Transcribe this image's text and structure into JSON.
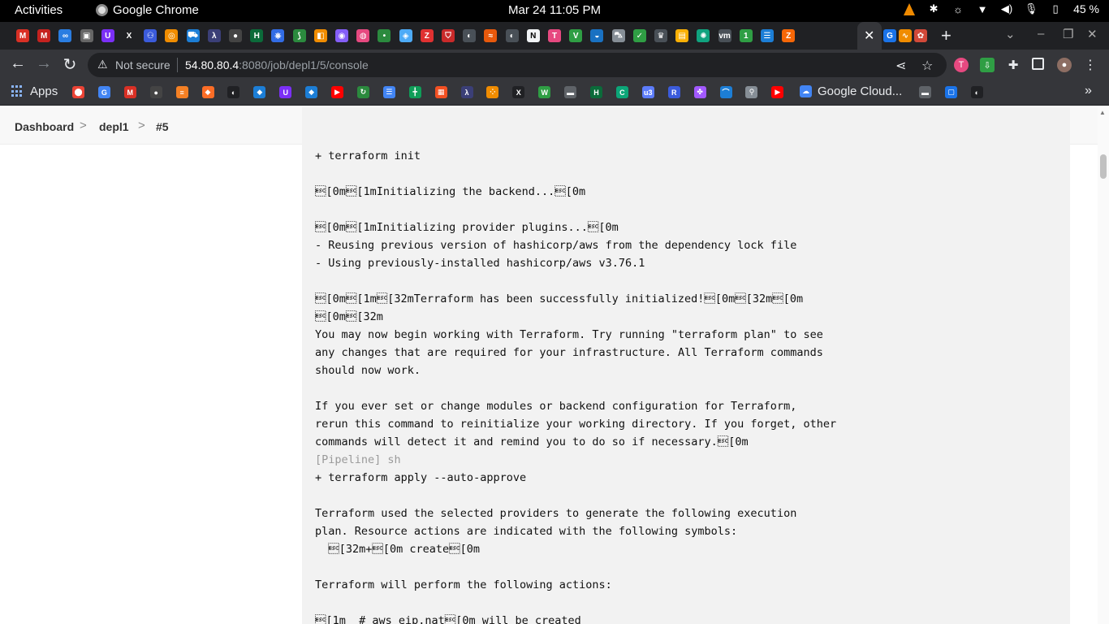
{
  "system_bar": {
    "activities": "Activities",
    "app_name": "Google Chrome",
    "clock": "Mar 24  11:05 PM",
    "battery": "45 %"
  },
  "tabstrip": {
    "favicons": [
      {
        "name": "gmail-icon",
        "color": "#d93025",
        "glyph": "M"
      },
      {
        "name": "gmail-icon",
        "color": "#c5221f",
        "glyph": "M"
      },
      {
        "name": "infinity-icon",
        "color": "#2a7de1",
        "glyph": "∞"
      },
      {
        "name": "terminal-icon",
        "color": "#666666",
        "glyph": "▣"
      },
      {
        "name": "udemy-icon",
        "color": "#7b2ff7",
        "glyph": "U"
      },
      {
        "name": "x-icon",
        "color": "#202124",
        "glyph": "X"
      },
      {
        "name": "users-icon",
        "color": "#3b5bdb",
        "glyph": "⚇"
      },
      {
        "name": "target-icon",
        "color": "#f08c00",
        "glyph": "◎"
      },
      {
        "name": "cart-icon",
        "color": "#1c7ed6",
        "glyph": "⛟"
      },
      {
        "name": "code-icon",
        "color": "#3b3f77",
        "glyph": "λ"
      },
      {
        "name": "github-icon",
        "color": "#444444",
        "glyph": "●"
      },
      {
        "name": "hi-icon",
        "color": "#0b6b3a",
        "glyph": "H"
      },
      {
        "name": "kubernetes-icon",
        "color": "#326ce5",
        "glyph": "⎈"
      },
      {
        "name": "leaf-icon",
        "color": "#2b8a3e",
        "glyph": "⟆"
      },
      {
        "name": "box-icon",
        "color": "#f08c00",
        "glyph": "◧"
      },
      {
        "name": "bot-icon",
        "color": "#845ef7",
        "glyph": "◉"
      },
      {
        "name": "record-icon",
        "color": "#e64980",
        "glyph": "◍"
      },
      {
        "name": "dot-icon",
        "color": "#2b8a3e",
        "glyph": "•"
      },
      {
        "name": "cube-icon",
        "color": "#4dabf7",
        "glyph": "◈"
      },
      {
        "name": "z-icon",
        "color": "#e03131",
        "glyph": "Z"
      },
      {
        "name": "shield-icon",
        "color": "#c92a2a",
        "glyph": "⛉"
      },
      {
        "name": "globe-icon",
        "color": "#495057",
        "glyph": "◐"
      },
      {
        "name": "flame-icon",
        "color": "#e8590c",
        "glyph": "≈"
      },
      {
        "name": "globe-icon",
        "color": "#495057",
        "glyph": "◐"
      },
      {
        "name": "notion-icon",
        "color": "#f1f3f5",
        "glyph": "N"
      },
      {
        "name": "t-icon",
        "color": "#e64980",
        "glyph": "T"
      },
      {
        "name": "v-icon",
        "color": "#2f9e44",
        "glyph": "V"
      },
      {
        "name": "planet-icon",
        "color": "#1971c2",
        "glyph": "◒"
      },
      {
        "name": "car-icon",
        "color": "#868e96",
        "glyph": "⛍"
      },
      {
        "name": "check-icon",
        "color": "#2f9e44",
        "glyph": "✓"
      },
      {
        "name": "crown-icon",
        "color": "#495057",
        "glyph": "♛"
      },
      {
        "name": "sheets-icon",
        "color": "#fab005",
        "glyph": "▤"
      },
      {
        "name": "openai-icon",
        "color": "#10a37f",
        "glyph": "✺"
      },
      {
        "name": "vm-icon",
        "color": "#495057",
        "glyph": "vm"
      },
      {
        "name": "one-icon",
        "color": "#2f9e44",
        "glyph": "1"
      },
      {
        "name": "list-icon",
        "color": "#1c7ed6",
        "glyph": "☰"
      },
      {
        "name": "z-icon",
        "color": "#f76707",
        "glyph": "Z"
      },
      {
        "name": "google-translate-icon",
        "color": "#1a73e8",
        "glyph": "G"
      },
      {
        "name": "grafana-icon",
        "color": "#f08c00",
        "glyph": "∿"
      },
      {
        "name": "jenkins-icon",
        "color": "#d24939",
        "glyph": "✿"
      }
    ]
  },
  "toolbar": {
    "not_secure": "Not secure",
    "url_host": "54.80.80.4",
    "url_path": ":8080/job/depl1/5/console"
  },
  "bookmarks": {
    "apps_label": "Apps",
    "gcloud_label": "Google Cloud...",
    "favicons": [
      {
        "name": "maps-icon",
        "color": "#ea4335",
        "glyph": "⬤"
      },
      {
        "name": "google-translate-icon",
        "color": "#4285f4",
        "glyph": "G"
      },
      {
        "name": "gmail-icon",
        "color": "#d93025",
        "glyph": "M"
      },
      {
        "name": "github-icon",
        "color": "#444444",
        "glyph": "●"
      },
      {
        "name": "stackoverflow-icon",
        "color": "#f48024",
        "glyph": "≡"
      },
      {
        "name": "gitlab-icon",
        "color": "#fc6d26",
        "glyph": "◆"
      },
      {
        "name": "globe-icon",
        "color": "#202124",
        "glyph": "◐"
      },
      {
        "name": "diamond-icon",
        "color": "#1c7ed6",
        "glyph": "◆"
      },
      {
        "name": "udemy-icon",
        "color": "#7b2ff7",
        "glyph": "U"
      },
      {
        "name": "diamond-icon",
        "color": "#1c7ed6",
        "glyph": "◆"
      },
      {
        "name": "youtube-icon",
        "color": "#ff0000",
        "glyph": "▶"
      },
      {
        "name": "refresh-icon",
        "color": "#2b8a3e",
        "glyph": "↻"
      },
      {
        "name": "docs-icon",
        "color": "#4285f4",
        "glyph": "☰"
      },
      {
        "name": "plus-icon",
        "color": "#0f9d58",
        "glyph": "╋"
      },
      {
        "name": "microsoft-icon",
        "color": "#f25022",
        "glyph": "▦"
      },
      {
        "name": "code-icon",
        "color": "#3b3f77",
        "glyph": "λ"
      },
      {
        "name": "nodes-icon",
        "color": "#f08c00",
        "glyph": "⁘"
      },
      {
        "name": "x-icon",
        "color": "#202124",
        "glyph": "X"
      },
      {
        "name": "w-icon",
        "color": "#2f9e44",
        "glyph": "W"
      },
      {
        "name": "folder-icon",
        "color": "#5f6368",
        "glyph": "▬"
      },
      {
        "name": "hi-icon",
        "color": "#0b6b3a",
        "glyph": "H"
      },
      {
        "name": "c-icon",
        "color": "#0ca678",
        "glyph": "C"
      },
      {
        "name": "u3-icon",
        "color": "#5c7cfa",
        "glyph": "u3"
      },
      {
        "name": "r-icon",
        "color": "#3b5bdb",
        "glyph": "R"
      },
      {
        "name": "figma-icon",
        "color": "#a259ff",
        "glyph": "✤"
      },
      {
        "name": "bridge-icon",
        "color": "#1c7ed6",
        "glyph": "⌒"
      },
      {
        "name": "pin-icon",
        "color": "#868e96",
        "glyph": "⚲"
      },
      {
        "name": "youtube-icon",
        "color": "#ff0000",
        "glyph": "▶"
      },
      {
        "name": "folder-icon",
        "color": "#5f6368",
        "glyph": "▬"
      },
      {
        "name": "square-icon",
        "color": "#1a73e8",
        "glyph": "▢"
      },
      {
        "name": "globe-icon",
        "color": "#202124",
        "glyph": "◐"
      }
    ]
  },
  "breadcrumb": {
    "dashboard": "Dashboard",
    "job": "depl1",
    "build": "#5",
    "separator": ">"
  },
  "console": {
    "lines": [
      {
        "text": "+ terraform init",
        "kind": "out"
      },
      {
        "text": "",
        "kind": "blank"
      },
      {
        "text": "\u001b[0m\u001b[1mInitializing the backend...\u001b[0m",
        "kind": "out"
      },
      {
        "text": "",
        "kind": "blank"
      },
      {
        "text": "\u001b[0m\u001b[1mInitializing provider plugins...\u001b[0m",
        "kind": "out"
      },
      {
        "text": "- Reusing previous version of hashicorp/aws from the dependency lock file",
        "kind": "out"
      },
      {
        "text": "- Using previously-installed hashicorp/aws v3.76.1",
        "kind": "out"
      },
      {
        "text": "",
        "kind": "blank"
      },
      {
        "text": "\u001b[0m\u001b[1m\u001b[32mTerraform has been successfully initialized!\u001b[0m\u001b[32m\u001b[0m",
        "kind": "out"
      },
      {
        "text": "\u001b[0m\u001b[32m",
        "kind": "out"
      },
      {
        "text": "You may now begin working with Terraform. Try running \"terraform plan\" to see",
        "kind": "out"
      },
      {
        "text": "any changes that are required for your infrastructure. All Terraform commands",
        "kind": "out"
      },
      {
        "text": "should now work.",
        "kind": "out"
      },
      {
        "text": "",
        "kind": "blank"
      },
      {
        "text": "If you ever set or change modules or backend configuration for Terraform,",
        "kind": "out"
      },
      {
        "text": "rerun this command to reinitialize your working directory. If you forget, other",
        "kind": "out"
      },
      {
        "text": "commands will detect it and remind you to do so if necessary.\u001b[0m",
        "kind": "out"
      },
      {
        "text": "[Pipeline] sh",
        "kind": "pipeline"
      },
      {
        "text": "+ terraform apply --auto-approve",
        "kind": "out"
      },
      {
        "text": "",
        "kind": "blank"
      },
      {
        "text": "Terraform used the selected providers to generate the following execution",
        "kind": "out"
      },
      {
        "text": "plan. Resource actions are indicated with the following symbols:",
        "kind": "out"
      },
      {
        "text": "  \u001b[32m+\u001b[0m create\u001b[0m",
        "kind": "out"
      },
      {
        "text": "",
        "kind": "blank"
      },
      {
        "text": "Terraform will perform the following actions:",
        "kind": "out"
      },
      {
        "text": "",
        "kind": "blank"
      },
      {
        "text": "\u001b[1m  # aws_eip.nat\u001b[0m will be created",
        "kind": "out"
      }
    ]
  }
}
